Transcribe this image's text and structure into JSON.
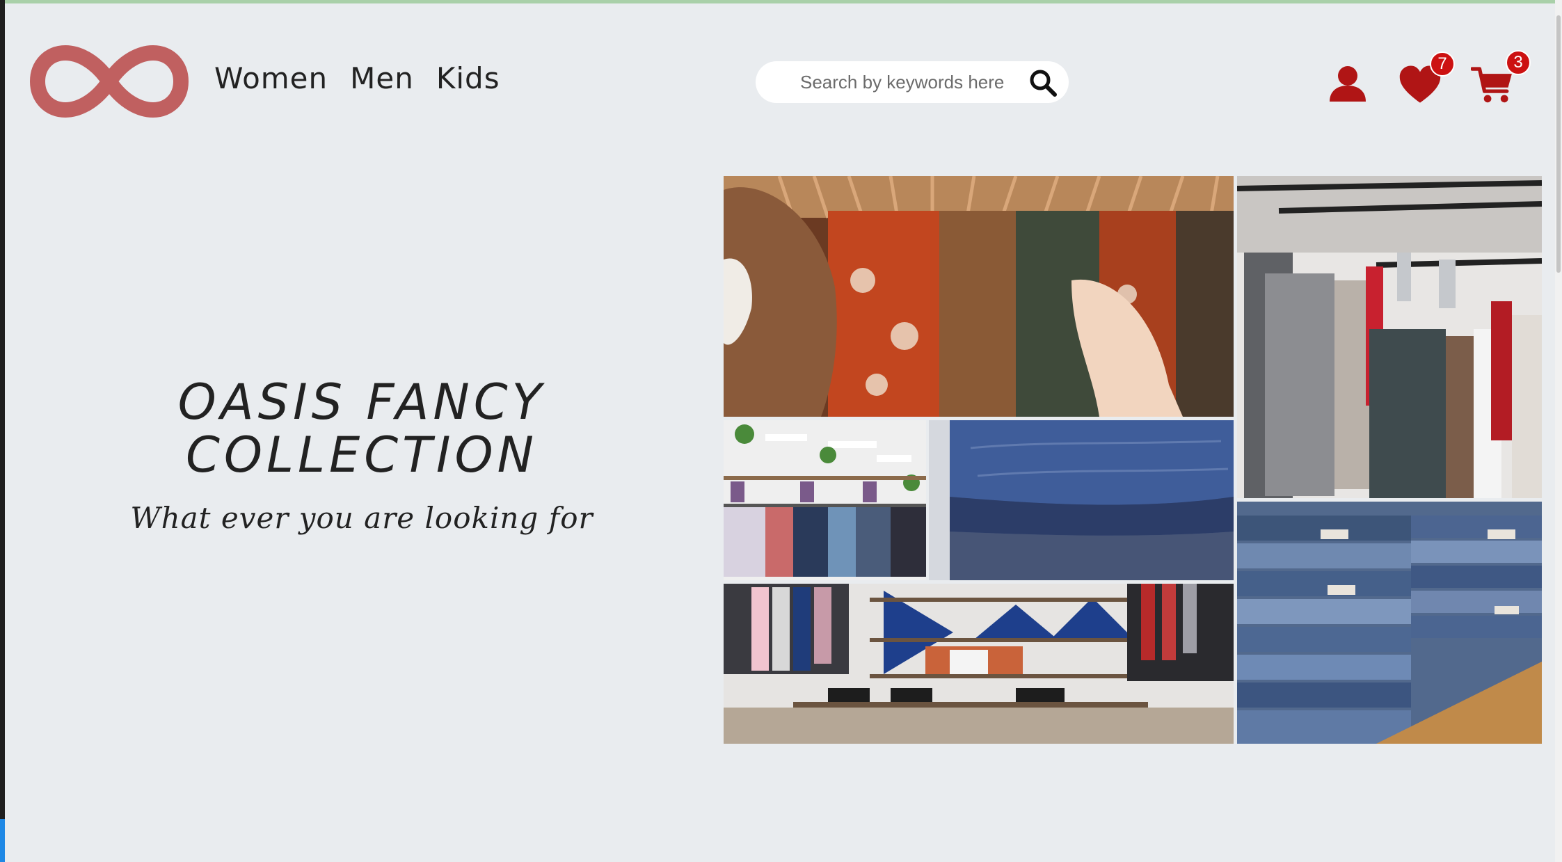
{
  "header": {
    "logo_icon": "infinity-logo-icon",
    "nav": [
      {
        "label": "Women"
      },
      {
        "label": "Men"
      },
      {
        "label": "Kids"
      }
    ],
    "search": {
      "placeholder": "Search by keywords here",
      "icon": "search-icon"
    },
    "account_icon": "user-icon",
    "wishlist": {
      "icon": "heart-icon",
      "count": "7"
    },
    "cart": {
      "icon": "cart-icon",
      "count": "3"
    }
  },
  "hero": {
    "title_line1": "OASIS FANCY",
    "title_line2": "COLLECTION",
    "subtitle": "What ever you are looking for"
  },
  "gallery": [
    {
      "name": "photo-browsing-clothes-rack"
    },
    {
      "name": "photo-sweaters-on-hangers"
    },
    {
      "name": "photo-store-interior"
    },
    {
      "name": "photo-folded-denim"
    },
    {
      "name": "photo-shop-shelves"
    },
    {
      "name": "photo-stacked-jeans"
    }
  ],
  "colors": {
    "background": "#e9ecef",
    "logo": "#c06060",
    "accent_red": "#b01515",
    "badge": "#cc1111",
    "text": "#222222"
  }
}
